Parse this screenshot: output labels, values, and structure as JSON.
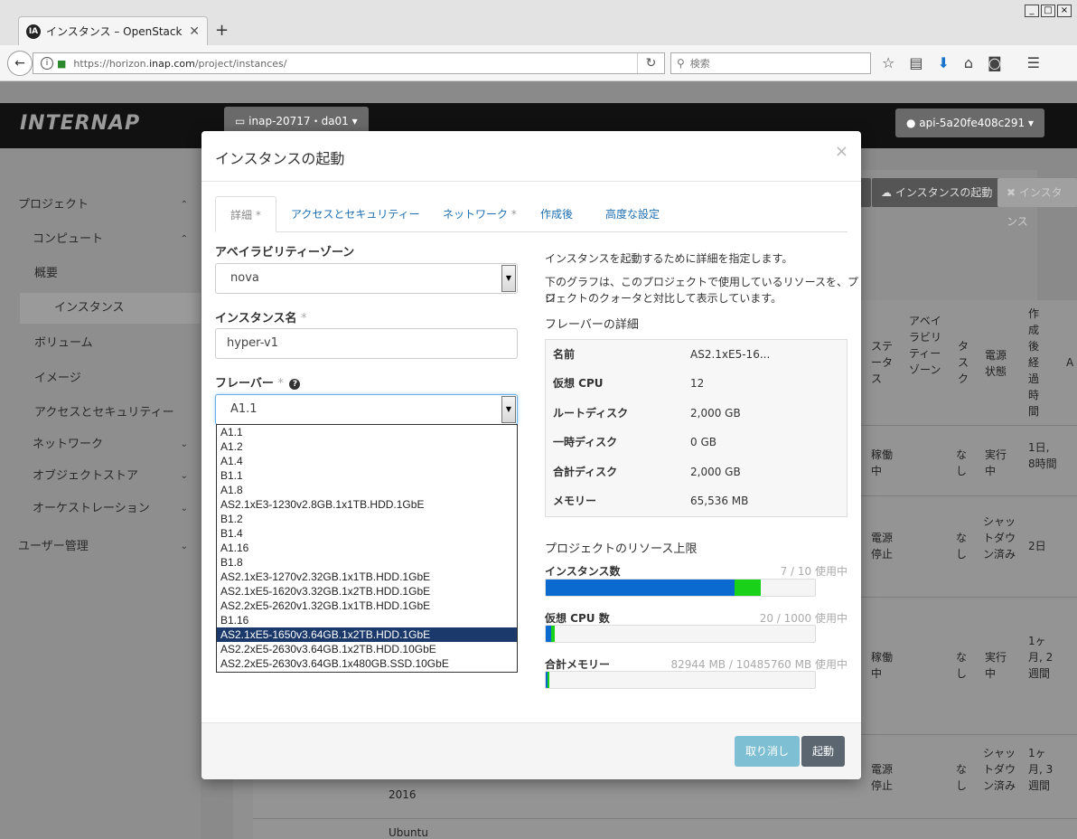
{
  "browser": {
    "tab_title": "インスタンス – OpenStack Dash",
    "tab_favicon": "IA",
    "url_prefix": "https://horizon.",
    "url_domain": "inap.com",
    "url_suffix": "/project/instances/",
    "search_placeholder": "検索",
    "window_controls": [
      "_",
      "□",
      "×"
    ]
  },
  "header": {
    "logo": "INTERNAP",
    "project_selector": "inap-20717・da01 ▾",
    "user_selector": "api-5a20fe408c291 ▾"
  },
  "sidebar": {
    "items": [
      {
        "label": "プロジェクト",
        "chev": "^"
      },
      {
        "label": "コンピュート",
        "chev": "^"
      },
      {
        "label": "概要"
      },
      {
        "label": "インスタンス"
      },
      {
        "label": "ボリューム"
      },
      {
        "label": "イメージ"
      },
      {
        "label": "アクセスとセキュリティー"
      },
      {
        "label": "ネットワーク",
        "chev": "v"
      },
      {
        "label": "オブジェクトストア",
        "chev": "v"
      },
      {
        "label": "オーケストレーション",
        "chev": "v"
      },
      {
        "label": "ユーザー管理",
        "chev": "v"
      }
    ]
  },
  "background": {
    "launch_button": "インスタンスの起動",
    "delete_button": "✖ インスタンス",
    "table_headers": {
      "status": "ステータス",
      "az": "アベイラビリティーゾーン",
      "task": "タスク",
      "power": "電源状態",
      "age": "作成後経過時間",
      "extra": "A"
    },
    "rows": [
      {
        "status": "稼働中",
        "task": "なし",
        "power": "実行中",
        "age": "1日, 8時間"
      },
      {
        "status": "電源停止",
        "task": "なし",
        "power": "シャットダウン済み",
        "age": "2日"
      },
      {
        "status": "稼働中",
        "task": "なし",
        "power": "実行中",
        "age": "1ヶ月, 2週間"
      },
      {
        "status": "電源停止",
        "task": "なし",
        "power": "シャットダウン済み",
        "age": "1ヶ月, 3週間"
      }
    ],
    "fragments": [
      "2016",
      "Ubuntu"
    ]
  },
  "modal": {
    "title": "インスタンスの起動",
    "close": "×",
    "tabs": [
      "詳細",
      "アクセスとセキュリティー",
      "ネットワーク",
      "作成後",
      "高度な設定"
    ],
    "tab_required_mark": "*",
    "az_label": "アベイラビリティーゾーン",
    "az_value": "nova",
    "name_label": "インスタンス名",
    "name_value": "hyper-v1",
    "flavor_label": "フレーバー",
    "flavor_value": "A1.1",
    "required_mark": "*",
    "help_icon": "?",
    "flavor_options": [
      "A1.1",
      "A1.2",
      "A1.4",
      "B1.1",
      "A1.8",
      "AS2.1xE3-1230v2.8GB.1x1TB.HDD.1GbE",
      "B1.2",
      "B1.4",
      "A1.16",
      "B1.8",
      "AS2.1xE3-1270v2.32GB.1x1TB.HDD.1GbE",
      "AS2.1xE5-1620v3.32GB.1x2TB.HDD.1GbE",
      "AS2.2xE5-2620v1.32GB.1x1TB.HDD.1GbE",
      "B1.16",
      "AS2.1xE5-1650v3.64GB.1x2TB.HDD.1GbE",
      "AS2.2xE5-2630v3.64GB.1x2TB.HDD.10GbE",
      "AS2.2xE5-2630v3.64GB.1x480GB.SSD.10GbE"
    ],
    "selected_option_index": 14,
    "intro": "インスタンスを起動するために詳細を指定します。",
    "graph_note_1": "下のグラフは、このプロジェクトで使用しているリソースを、プロ",
    "graph_note_2": "ジェクトのクォータと対比して表示しています。",
    "flavor_details_title": "フレーバーの詳細",
    "flavor_details": [
      {
        "k": "名前",
        "v": "AS2.1xE5-16..."
      },
      {
        "k": "仮想 CPU",
        "v": "12"
      },
      {
        "k": "ルートディスク",
        "v": "2,000 GB"
      },
      {
        "k": "一時ディスク",
        "v": "0 GB"
      },
      {
        "k": "合計ディスク",
        "v": "2,000 GB"
      },
      {
        "k": "メモリー",
        "v": "65,536 MB"
      }
    ],
    "limits_title": "プロジェクトのリソース上限",
    "quotas": [
      {
        "label": "インスタンス数",
        "value": "7 / 10 使用中",
        "used_fraction": 0.7,
        "added_fraction": 0.1
      },
      {
        "label": "仮想 CPU 数",
        "value": "20 / 1000 使用中",
        "used_fraction": 0.02,
        "added_fraction": 0.012
      },
      {
        "label": "合計メモリー",
        "value": "82944 MB / 10485760 MB 使用中",
        "used_fraction": 0.008,
        "added_fraction": 0.006
      }
    ],
    "cancel_button": "取り消し",
    "launch_button": "起動"
  },
  "colors": {
    "quota_used": "#0a6acf",
    "quota_added": "#19d119",
    "selected_option": "#1b3a6b",
    "cancel_button": "#7fbfd3",
    "launch_button": "#5b6670"
  }
}
